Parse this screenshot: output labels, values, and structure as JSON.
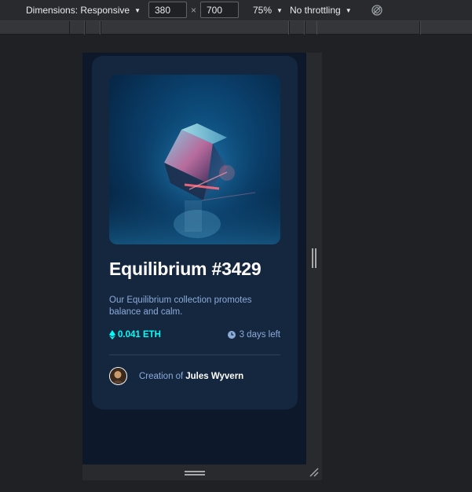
{
  "devtools": {
    "dimensions_label": "Dimensions: Responsive",
    "width_value": "380",
    "times_symbol": "×",
    "height_value": "700",
    "zoom": "75%",
    "throttling": "No throttling",
    "caret": "▼"
  },
  "card": {
    "title": "Equilibrium #3429",
    "description": "Our Equilibrium collection promotes balance and calm.",
    "price": "0.041 ETH",
    "time_left": "3 days left",
    "creator_prefix": "Creation of",
    "creator_name": "Jules Wyvern"
  },
  "colors": {
    "page_bg": "#0d192b",
    "card_bg": "#15263f",
    "accent_cyan": "#00fff8",
    "soft_blue": "#8bacd9",
    "white": "#ffffff"
  },
  "icons": {
    "eth": "ethereum-icon",
    "clock": "clock-icon",
    "rotate": "rotate-icon"
  }
}
